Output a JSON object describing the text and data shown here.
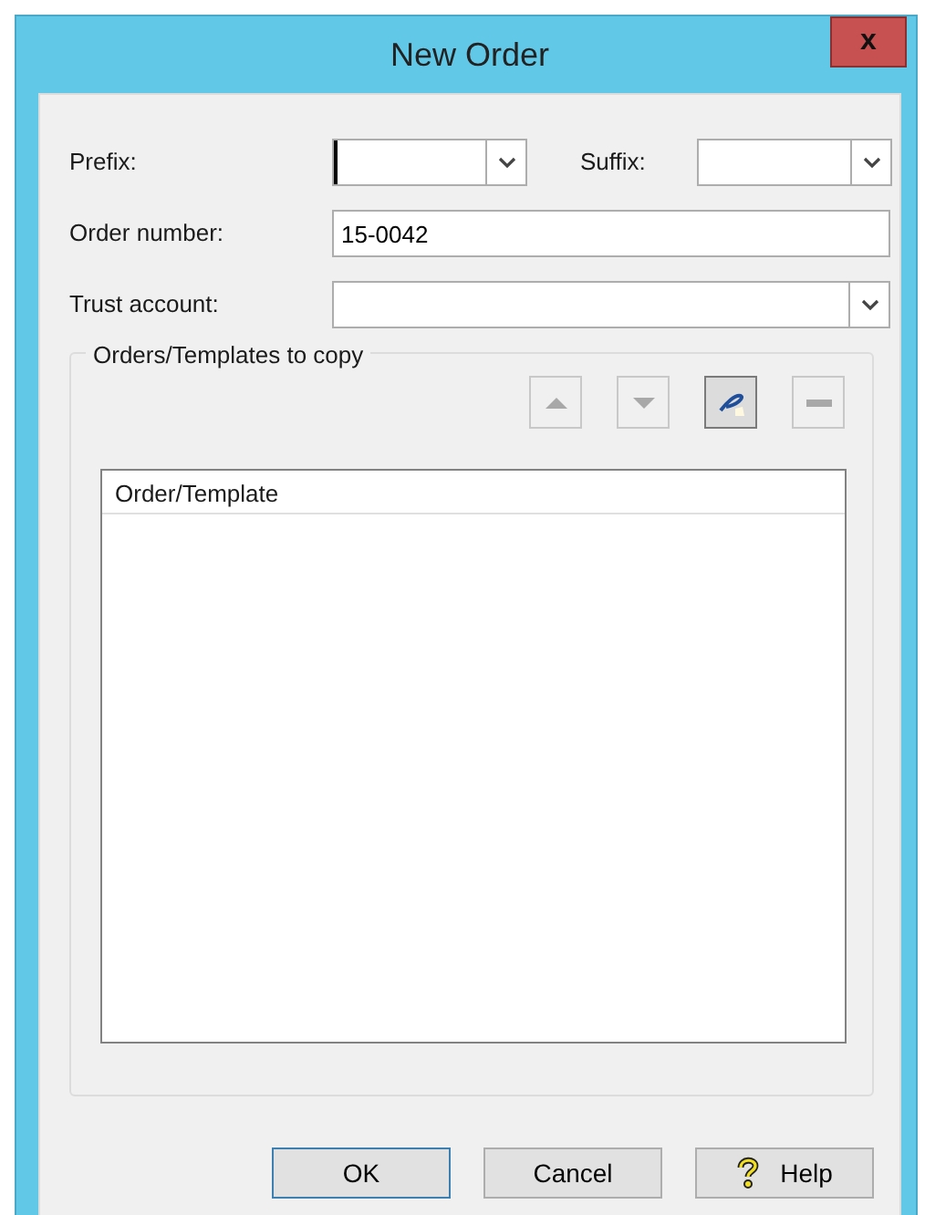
{
  "window": {
    "title": "New Order",
    "close": "x"
  },
  "fields": [
    {
      "label": "Prefix:",
      "focused": true
    },
    {
      "label": "Suffix:",
      "focused": false
    },
    {
      "label": "Order number:",
      "value": "15-0042",
      "focused": false
    },
    {
      "label": "Trust account:",
      "focused": false
    }
  ],
  "group": {
    "title": "Orders/Templates to copy",
    "toolbar": [
      {
        "kind": "up",
        "disabled": true
      },
      {
        "kind": "down",
        "disabled": true
      },
      {
        "kind": "edit",
        "disabled": false
      },
      {
        "kind": "remove",
        "disabled": true
      }
    ],
    "list": {
      "columns": [
        "Order/Template"
      ]
    }
  },
  "buttons": [
    {
      "label": "OK",
      "default": true,
      "kind": "plain"
    },
    {
      "label": "Cancel",
      "default": false,
      "kind": "plain"
    },
    {
      "label": "Help",
      "default": false,
      "kind": "help"
    }
  ]
}
